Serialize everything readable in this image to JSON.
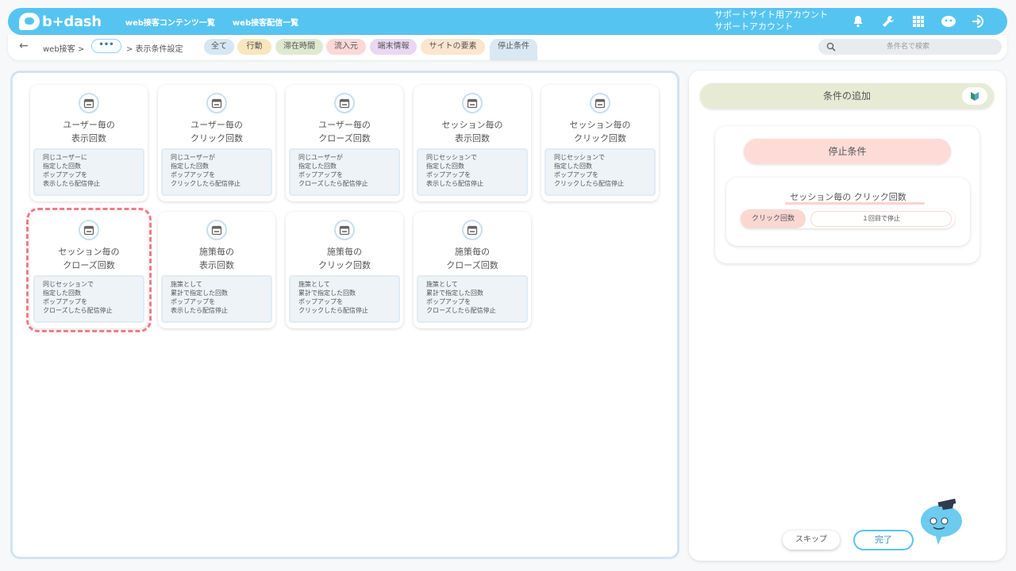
{
  "header": {
    "brand": "b+dash",
    "nav": [
      "web接客コンテンツ一覧",
      "web接客配信一覧"
    ],
    "account_line1": "サポートサイト用アカウント",
    "account_line2": "サポートアカウント",
    "icons": [
      "bell-icon",
      "wrench-icon",
      "grid-icon",
      "mascot-chat-icon",
      "logout-icon"
    ]
  },
  "breadcrumb": {
    "back": "←",
    "root": "web接客 >",
    "ellipsis": "•••",
    "current": "> 表示条件設定"
  },
  "tabs": [
    {
      "label": "全て",
      "color": "#d6e6f3"
    },
    {
      "label": "行動",
      "color": "#f8e6be"
    },
    {
      "label": "滞在時間",
      "color": "#dfe9d0"
    },
    {
      "label": "流入元",
      "color": "#fbd8d6"
    },
    {
      "label": "端末情報",
      "color": "#ead7f3"
    },
    {
      "label": "サイトの要素",
      "color": "#fbe5cf"
    },
    {
      "label": "停止条件",
      "color": "#d9e8f3",
      "active": true
    }
  ],
  "search": {
    "placeholder": "条件名で検索"
  },
  "cards": [
    {
      "title1": "ユーザー毎の",
      "title2": "表示回数",
      "desc": [
        "同じユーザーに",
        "指定した回数",
        "ポップアップを",
        "表示したら配信停止"
      ]
    },
    {
      "title1": "ユーザー毎の",
      "title2": "クリック回数",
      "desc": [
        "同じユーザーが",
        "指定した回数",
        "ポップアップを",
        "クリックしたら配信停止"
      ]
    },
    {
      "title1": "ユーザー毎の",
      "title2": "クローズ回数",
      "desc": [
        "同じユーザーが",
        "指定した回数",
        "ポップアップを",
        "クローズしたら配信停止"
      ]
    },
    {
      "title1": "セッション毎の",
      "title2": "表示回数",
      "desc": [
        "同じセッションで",
        "指定した回数",
        "ポップアップを",
        "表示したら配信停止"
      ]
    },
    {
      "title1": "セッション毎の",
      "title2": "クリック回数",
      "desc": [
        "同じセッションで",
        "指定した回数",
        "ポップアップを",
        "クリックしたら配信停止"
      ]
    },
    {
      "title1": "セッション毎の",
      "title2": "クローズ回数",
      "desc": [
        "同じセッションで",
        "指定した回数",
        "ポップアップを",
        "クローズしたら配信停止"
      ],
      "selected": true
    },
    {
      "title1": "施策毎の",
      "title2": "表示回数",
      "desc": [
        "施策として",
        "累計で指定した回数",
        "ポップアップを",
        "表示したら配信停止"
      ]
    },
    {
      "title1": "施策毎の",
      "title2": "クリック回数",
      "desc": [
        "施策として",
        "累計で指定した回数",
        "ポップアップを",
        "クリックしたら配信停止"
      ]
    },
    {
      "title1": "施策毎の",
      "title2": "クローズ回数",
      "desc": [
        "施策として",
        "累計で指定した回数",
        "ポップアップを",
        "クローズしたら配信停止"
      ]
    }
  ],
  "right": {
    "add_condition": "条件の追加",
    "stop_header": "停止条件",
    "condition_title": "セッション毎の クリック回数",
    "condition_label": "クリック回数",
    "condition_value": "１回目で停止",
    "skip": "スキップ",
    "done": "完了"
  },
  "colors": {
    "accent": "#56c4f1",
    "selected_outline": "#f27a87"
  }
}
